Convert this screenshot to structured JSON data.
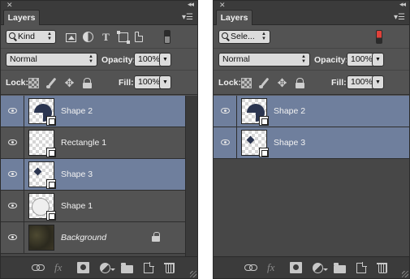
{
  "colors": {
    "panel_bg": "#535353",
    "selected_layer": "#6f7f9d",
    "filter_toggle_active": "#e0413a",
    "filter_toggle_inactive": "#2b2b2b",
    "shape_fill": "#2b3550"
  },
  "left_panel": {
    "tab_label": "Layers",
    "filter_kind": "Kind",
    "filter_toggle_on": false,
    "blend_mode": "Normal",
    "opacity_label": "Opacity:",
    "opacity_value": "100%",
    "lock_label": "Lock:",
    "fill_label": "Fill:",
    "fill_value": "100%",
    "layers": [
      {
        "name": "Shape 2",
        "selected": true,
        "thumb": "pie-shape",
        "vector": true
      },
      {
        "name": "Rectangle 1",
        "selected": false,
        "thumb": "empty",
        "vector": true
      },
      {
        "name": "Shape 3",
        "selected": true,
        "thumb": "diamond-shape",
        "vector": true
      },
      {
        "name": "Shape 1",
        "selected": false,
        "thumb": "circle-outline",
        "vector": true
      },
      {
        "name": "Background",
        "selected": false,
        "thumb": "background-texture",
        "vector": false,
        "locked": true
      }
    ]
  },
  "right_panel": {
    "tab_label": "Layers",
    "filter_kind": "Sele...",
    "filter_toggle_on": true,
    "blend_mode": "Normal",
    "opacity_label": "Opacity:",
    "opacity_value": "100%",
    "lock_label": "Lock:",
    "fill_label": "Fill:",
    "fill_value": "100%",
    "layers": [
      {
        "name": "Shape 2",
        "selected": true,
        "thumb": "pie-shape",
        "vector": true
      },
      {
        "name": "Shape 3",
        "selected": true,
        "thumb": "diamond-shape",
        "vector": true
      }
    ]
  },
  "icons": {
    "close": "close-icon",
    "collapse": "collapse-arrows-icon",
    "panel_menu": "panel-menu-icon",
    "filters": [
      "pixel-layer-filter-icon",
      "adjustment-layer-filter-icon",
      "type-layer-filter-icon",
      "shape-layer-filter-icon",
      "smart-object-filter-icon"
    ],
    "locks": [
      "lock-transparent-pixels-icon",
      "lock-image-pixels-icon",
      "lock-position-icon",
      "lock-all-icon"
    ],
    "footer": [
      "link-layers-icon",
      "layer-style-fx-icon",
      "add-mask-icon",
      "adjustment-layer-icon",
      "new-group-icon",
      "new-layer-icon",
      "delete-layer-icon"
    ]
  }
}
